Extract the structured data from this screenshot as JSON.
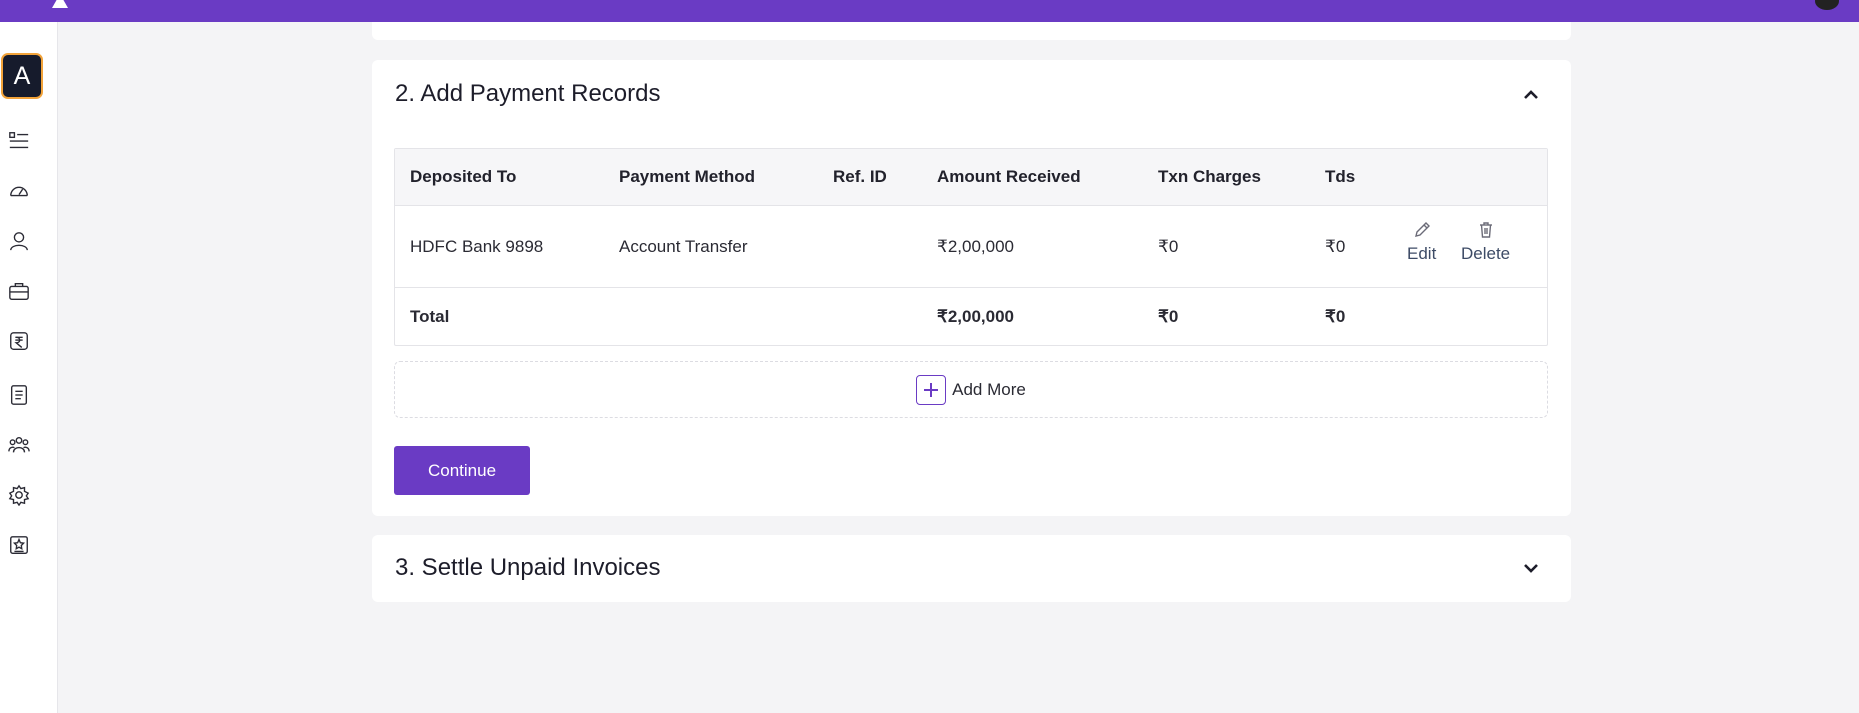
{
  "app": {
    "brand_color": "#6a3bc4",
    "avatar_letter": "A"
  },
  "sidebar": {
    "items": [
      {
        "icon": "list-icon"
      },
      {
        "icon": "dashboard-gauge-icon"
      },
      {
        "icon": "user-icon"
      },
      {
        "icon": "briefcase-icon"
      },
      {
        "icon": "rupee-icon"
      },
      {
        "icon": "document-icon"
      },
      {
        "icon": "team-icon"
      },
      {
        "icon": "settings-gear-icon"
      },
      {
        "icon": "badge-star-icon"
      }
    ]
  },
  "payment_section": {
    "title": "2. Add Payment Records",
    "expanded": true,
    "table": {
      "headers": [
        "Deposited To",
        "Payment Method",
        "Ref. ID",
        "Amount Received",
        "Txn Charges",
        "Tds"
      ],
      "rows": [
        {
          "deposited_to": "HDFC Bank 9898",
          "payment_method": "Account Transfer",
          "ref_id": "",
          "amount_received": "₹2,00,000",
          "txn_charges": "₹0",
          "tds": "₹0",
          "actions": {
            "edit": "Edit",
            "delete": "Delete"
          }
        }
      ],
      "total": {
        "label": "Total",
        "amount_received": "₹2,00,000",
        "txn_charges": "₹0",
        "tds": "₹0"
      }
    },
    "add_more_label": "Add More",
    "continue_label": "Continue"
  },
  "settle_section": {
    "title": "3. Settle Unpaid Invoices",
    "expanded": false
  }
}
